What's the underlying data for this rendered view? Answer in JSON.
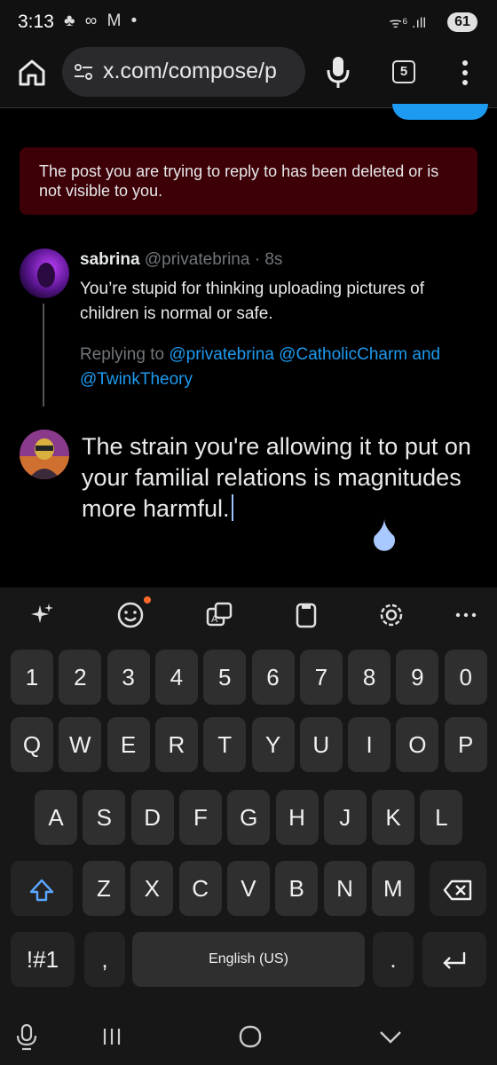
{
  "status_bar": {
    "time": "3:13",
    "left_icons": "♣ ∞ M •",
    "right_icons": "ᯤ⁶ .ıll",
    "battery": "61"
  },
  "browser": {
    "url": "x.com/compose/p",
    "tab_count": "5"
  },
  "error_banner": {
    "text": "The post you are trying to reply to has been deleted or is not visible to you."
  },
  "original_tweet": {
    "name": "sabrina",
    "handle": "@privatebrina",
    "time": "· 8s",
    "body": "You’re stupid for thinking uploading pictures of children is normal or safe.",
    "replying_prefix": "Replying to ",
    "replying_handles": "@privatebrina @CatholicCharm",
    "replying_and": " and ",
    "replying_last": "@TwinkTheory"
  },
  "compose": {
    "text": "The strain you're allowing it to put on your familial relations is magnitudes more harmful."
  },
  "keyboard": {
    "row1": [
      "1",
      "2",
      "3",
      "4",
      "5",
      "6",
      "7",
      "8",
      "9",
      "0"
    ],
    "row2": [
      "Q",
      "W",
      "E",
      "R",
      "T",
      "Y",
      "U",
      "I",
      "O",
      "P"
    ],
    "row3": [
      "A",
      "S",
      "D",
      "F",
      "G",
      "H",
      "J",
      "K",
      "L"
    ],
    "row4": [
      "Z",
      "X",
      "C",
      "V",
      "B",
      "N",
      "M"
    ],
    "symbols_label": "!#1",
    "comma": ",",
    "space_label": "English (US)",
    "period": "."
  },
  "colors": {
    "accent": "#1d9bf0",
    "error_bg": "#3d0007",
    "muted": "#71767b"
  }
}
